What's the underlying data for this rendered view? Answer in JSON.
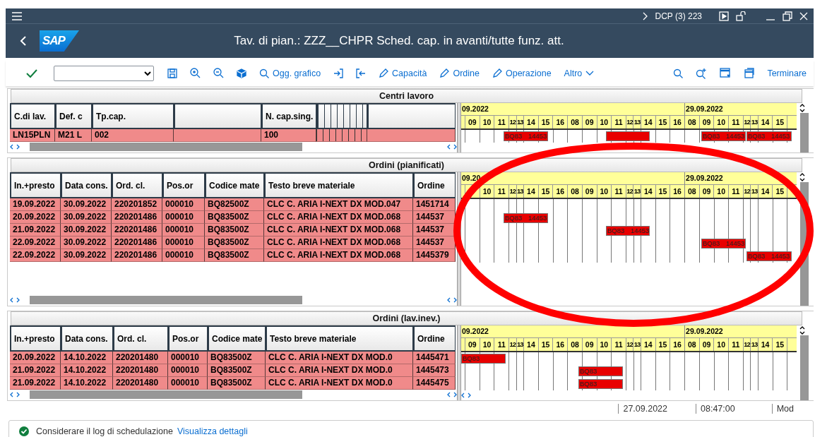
{
  "shell": {
    "system": "DCP (3) 223"
  },
  "header": {
    "logo": "SAP",
    "title": "Tav. di pian.: ZZZ__CHPR Sched. cap. in avanti/tutte funz. att."
  },
  "toolbar": {
    "buttons": [
      {
        "kind": "search",
        "label": "Ogg. grafico"
      },
      {
        "kind": "pencil",
        "label": "Capacità"
      },
      {
        "kind": "pencil",
        "label": "Ordine"
      },
      {
        "kind": "pencil",
        "label": "Operazione"
      },
      {
        "kind": "menu",
        "label": "Altro"
      }
    ],
    "exit_button": "Terminare"
  },
  "sections": [
    {
      "title": "Centri lavoro",
      "columns": [
        {
          "kind": "label",
          "label": "C.di lav."
        },
        {
          "kind": "label",
          "label": "Def. c"
        },
        {
          "kind": "label",
          "label": "Tp.cap."
        },
        {
          "kind": "blank"
        },
        {
          "kind": "label",
          "label": "N. cap.sing."
        },
        {
          "kind": "narrow"
        },
        {
          "kind": "blank"
        }
      ],
      "rows": [
        [
          "LN15PLN",
          "M21 L",
          "002",
          "100"
        ]
      ],
      "timeline": {
        "dates": [
          "09.2022",
          "29.09.2022"
        ],
        "hours": [
          "09",
          "10",
          "11",
          "12",
          "13",
          "14",
          "15",
          "16",
          "08",
          "09",
          "10",
          "11",
          "12",
          "13",
          "14",
          "15",
          "16",
          "08",
          "09",
          "10",
          "11",
          "12",
          "13",
          "14",
          "15"
        ],
        "bars": [
          {
            "kind": "labelled",
            "label": "BQ83 14453"
          },
          {
            "kind": "plain"
          },
          {
            "kind": "labelled",
            "label": "BQ83 14453"
          },
          {
            "kind": "labelled",
            "label": "BQ83 14453"
          }
        ]
      }
    },
    {
      "title": "Ordini (pianificati)",
      "columns": [
        {
          "kind": "label",
          "label": "In.+presto"
        },
        {
          "kind": "label",
          "label": "Data cons."
        },
        {
          "kind": "label",
          "label": "Ord. cl."
        },
        {
          "kind": "label",
          "label": "Pos.or"
        },
        {
          "kind": "label",
          "label": "Codice mate"
        },
        {
          "kind": "label",
          "label": "Testo breve materiale"
        },
        {
          "kind": "label",
          "label": "Ordine"
        }
      ],
      "rows": [
        [
          "19.09.2022",
          "30.09.2022",
          "220201852",
          "000010",
          "BQ82500Z",
          "CLC C. ARIA I-NEXT DX MOD.047",
          "1451714"
        ],
        [
          "20.09.2022",
          "30.09.2022",
          "220201486",
          "000010",
          "BQ83500Z",
          "CLC C. ARIA I-NEXT DX MOD.068",
          "144537"
        ],
        [
          "21.09.2022",
          "30.09.2022",
          "220201486",
          "000010",
          "BQ83500Z",
          "CLC C. ARIA I-NEXT DX MOD.068",
          "144537"
        ],
        [
          "22.09.2022",
          "30.09.2022",
          "220201486",
          "000010",
          "BQ83500Z",
          "CLC C. ARIA I-NEXT DX MOD.068",
          "144537"
        ],
        [
          "22.09.2022",
          "30.09.2022",
          "220201486",
          "000010",
          "BQ83500Z",
          "CLC C. ARIA I-NEXT DX MOD.068",
          "1445379"
        ]
      ],
      "timeline": {
        "dates": [
          "09.20",
          "29.09.2022"
        ],
        "hours": [
          "10",
          "11",
          "12",
          "13",
          "14",
          "15",
          "16",
          "08",
          "09",
          "10",
          "11",
          "12",
          "13",
          "14",
          "15",
          "16",
          "08",
          "09",
          "10",
          "11",
          "12",
          "13",
          "14",
          "15"
        ],
        "bars": [
          {
            "kind": "labelled",
            "label": "BQ83 14453"
          },
          {
            "kind": "labelled",
            "label": "BQ83 14453"
          },
          {
            "kind": "labelled",
            "label": "BQ83 14453"
          },
          {
            "kind": "labelled",
            "label": "BQ83 14453"
          }
        ]
      }
    },
    {
      "title": "Ordini (lav.inev.)",
      "columns": [
        {
          "kind": "label",
          "label": "In.+presto"
        },
        {
          "kind": "label",
          "label": "Data cons."
        },
        {
          "kind": "label",
          "label": "Ord. cl."
        },
        {
          "kind": "label",
          "label": "Pos.or"
        },
        {
          "kind": "label",
          "label": "Codice mate"
        },
        {
          "kind": "label",
          "label": "Testo breve materiale"
        },
        {
          "kind": "label",
          "label": "Ordine"
        }
      ],
      "rows": [
        [
          "20.09.2022",
          "14.10.2022",
          "220201480",
          "000010",
          "BQ83500Z",
          "CLC C. ARIA I-NEXT DX MOD.0",
          "1445471"
        ],
        [
          "21.09.2022",
          "14.10.2022",
          "220201480",
          "000010",
          "BQ83500Z",
          "CLC C. ARIA I-NEXT DX MOD.0",
          "1445473"
        ],
        [
          "21.09.2022",
          "14.10.2022",
          "220201480",
          "000010",
          "BQ83500Z",
          "CLC C. ARIA I-NEXT DX MOD.0",
          "1445475"
        ]
      ],
      "timeline": {
        "dates": [
          "09.2022",
          "29.09.2022"
        ],
        "hours": [
          "09",
          "10",
          "11",
          "12",
          "13",
          "14",
          "15",
          "16",
          "08",
          "09",
          "10",
          "11",
          "12",
          "13",
          "14",
          "15",
          "16",
          "08",
          "09",
          "10",
          "11",
          "12",
          "13",
          "14",
          "15"
        ],
        "bars": [
          {
            "kind": "labelled",
            "label": "BQ83"
          },
          {
            "kind": "labelled",
            "label": "BQ83"
          },
          {
            "kind": "labelled",
            "label": "BQ83"
          }
        ]
      }
    }
  ],
  "status_bar": [
    "27.09.2022",
    "08:47:00",
    "Mod"
  ],
  "message": {
    "text": "Considerare il log di schedulazione",
    "link": "Visualizza dettagli"
  }
}
